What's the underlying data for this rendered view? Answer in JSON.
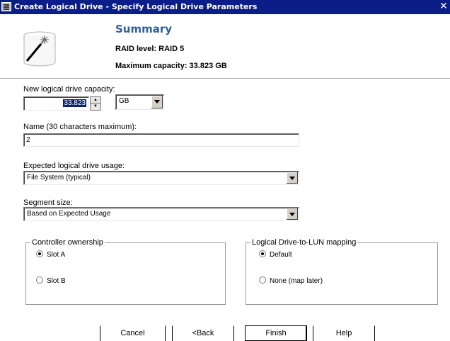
{
  "window": {
    "title": "Create Logical Drive - Specify Logical Drive Parameters",
    "close_glyph": "✕"
  },
  "summary": {
    "heading": "Summary",
    "raid_level": "RAID level: RAID 5",
    "max_capacity": "Maximum capacity: 33.823 GB"
  },
  "capacity": {
    "label": "New logical drive capacity:",
    "value": "33.823",
    "unit": "GB"
  },
  "name_field": {
    "label": "Name (30 characters maximum):",
    "value": "2"
  },
  "usage": {
    "label": "Expected logical drive usage:",
    "value": "File System (typical)"
  },
  "segment": {
    "label": "Segment size:",
    "value": "Based on Expected Usage"
  },
  "controller_ownership": {
    "legend": "Controller ownership",
    "options": [
      {
        "label": "Slot A",
        "checked": true
      },
      {
        "label": "Slot B",
        "checked": false
      }
    ]
  },
  "lun_mapping": {
    "legend": "Logical Drive-to-LUN mapping",
    "options": [
      {
        "label": "Default",
        "checked": true
      },
      {
        "label": "None (map later)",
        "checked": false
      }
    ]
  },
  "buttons": {
    "cancel": "Cancel",
    "back": "<Back",
    "finish": "Finish",
    "help": "Help"
  },
  "icons": {
    "app": "grid-window-icon",
    "wizard": "magic-wand-icon",
    "close": "close-icon"
  },
  "colors": {
    "titlebar": "#0b1d87",
    "summary_heading": "#2f5f9e",
    "selection": "#0a246a"
  }
}
